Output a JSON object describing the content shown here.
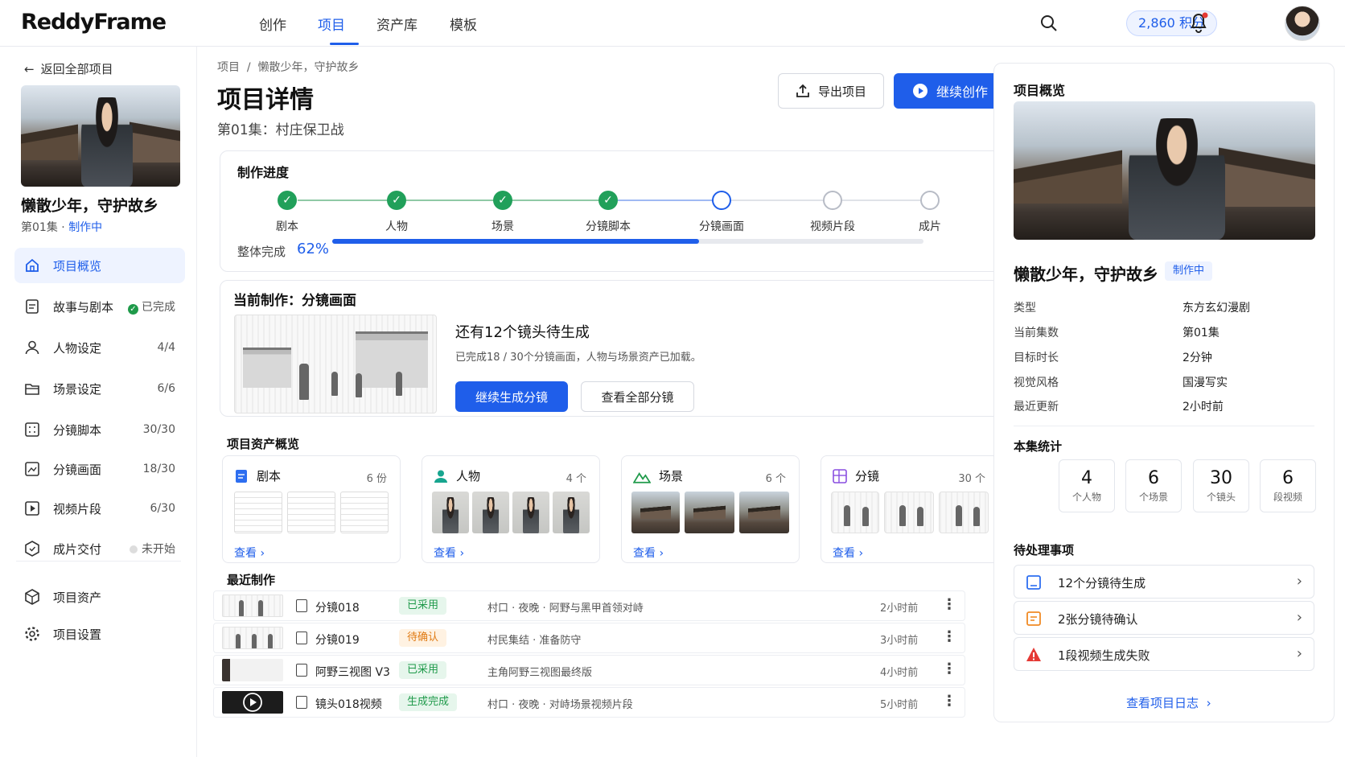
{
  "app": {
    "name": "ReddyFrame"
  },
  "topnav": {
    "items": [
      "创作",
      "项目",
      "资产库",
      "模板"
    ],
    "active": "项目"
  },
  "header": {
    "points": "2,860 积分"
  },
  "sidebar": {
    "back": "返回全部项目",
    "project_title": "懒散少年，守护故乡",
    "episode": "第01集",
    "status": "制作中",
    "items": [
      {
        "label": "项目概览",
        "count": ""
      },
      {
        "label": "故事与剧本",
        "count": "已完成"
      },
      {
        "label": "人物设定",
        "count": "4/4"
      },
      {
        "label": "场景设定",
        "count": "6/6"
      },
      {
        "label": "分镜脚本",
        "count": "30/30"
      },
      {
        "label": "分镜画面",
        "count": "18/30"
      },
      {
        "label": "视频片段",
        "count": "6/30"
      },
      {
        "label": "成片交付",
        "count": "未开始"
      }
    ],
    "bottom": [
      {
        "label": "项目资产"
      },
      {
        "label": "项目设置"
      }
    ]
  },
  "main": {
    "breadcrumb": [
      "项目",
      "懒散少年，守护故乡"
    ],
    "title": "项目详情",
    "subtitle": "第01集：村庄保卫战",
    "export_label": "导出项目",
    "continue_label": "继续创作",
    "progress": {
      "title": "制作进度",
      "steps": [
        "剧本",
        "人物",
        "场景",
        "分镜脚本",
        "分镜画面",
        "视频片段",
        "成片"
      ],
      "status": [
        "done",
        "done",
        "done",
        "done",
        "current",
        "todo",
        "todo"
      ],
      "overall_label": "整体完成",
      "overall_value": "62%",
      "overall_fraction": 0.62
    },
    "current": {
      "title": "当前制作：分镜画面",
      "headline": "还有12个镜头待生成",
      "detail": "已完成18 / 30个分镜画面，人物与场景资产已加载。",
      "primary": "继续生成分镜",
      "secondary": "查看全部分镜"
    },
    "assets": {
      "title": "项目资产概览",
      "view_label": "查看",
      "cards": [
        {
          "name": "剧本",
          "count": "6 份"
        },
        {
          "name": "人物",
          "count": "4 个"
        },
        {
          "name": "场景",
          "count": "6 个"
        },
        {
          "name": "分镜",
          "count": "30 个"
        }
      ]
    },
    "recent": {
      "title": "最近制作",
      "rows": [
        {
          "name": "分镜018",
          "tag": "已采用",
          "desc": "村口 · 夜晚 · 阿野与黑甲首领对峙",
          "time": "2小时前"
        },
        {
          "name": "分镜019",
          "tag": "待确认",
          "desc": "村民集结 · 准备防守",
          "time": "3小时前"
        },
        {
          "name": "阿野三视图 V3",
          "tag": "已采用",
          "desc": "主角阿野三视图最终版",
          "time": "4小时前"
        },
        {
          "name": "镜头018视频",
          "tag": "生成完成",
          "desc": "村口 · 夜晚 · 对峙场景视频片段",
          "time": "5小时前"
        }
      ]
    }
  },
  "overview": {
    "title": "项目概览",
    "project_title": "懒散少年，守护故乡",
    "badge": "制作中",
    "fields": [
      {
        "k": "类型",
        "v": "东方玄幻漫剧"
      },
      {
        "k": "当前集数",
        "v": "第01集"
      },
      {
        "k": "目标时长",
        "v": "2分钟"
      },
      {
        "k": "视觉风格",
        "v": "国漫写实"
      },
      {
        "k": "最近更新",
        "v": "2小时前"
      }
    ],
    "stats_title": "本集统计",
    "stats": [
      {
        "num": "4",
        "label": "个人物"
      },
      {
        "num": "6",
        "label": "个场景"
      },
      {
        "num": "30",
        "label": "个镜头"
      },
      {
        "num": "6",
        "label": "段视频"
      }
    ],
    "todo_title": "待处理事项",
    "todos": [
      {
        "text": "12个分镜待生成"
      },
      {
        "text": "2张分镜待确认"
      },
      {
        "text": "1段视频生成失败"
      }
    ],
    "log_link": "查看项目日志"
  },
  "colors": {
    "primary": "#1f5eea",
    "success": "#1f9a4a",
    "warning": "#e07b14",
    "danger": "#e53935"
  }
}
